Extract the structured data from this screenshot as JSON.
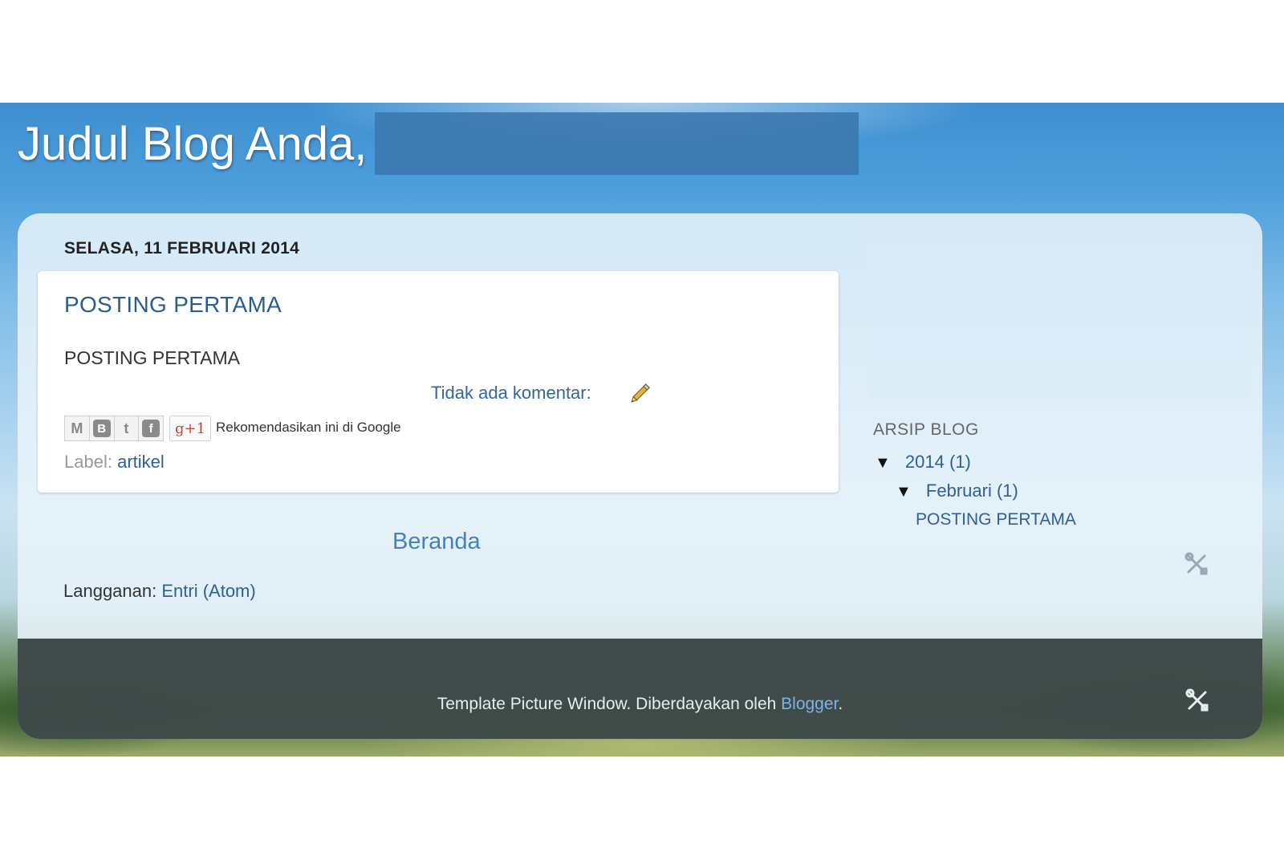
{
  "header": {
    "title": "Judul Blog Anda,"
  },
  "main": {
    "date_header": "SELASA, 11 FEBRUARI 2014",
    "post": {
      "title": "POSTING PERTAMA",
      "body": "POSTING PERTAMA",
      "comment_link": "Tidak ada komentar:",
      "share_buttons": [
        "M",
        "B",
        "t",
        "f"
      ],
      "gplus_label": "g+1",
      "recommend_text": "Rekomendasikan ini di Google",
      "labels_prefix": "Label:",
      "label_link": "artikel"
    },
    "home_link": "Beranda",
    "subscribe_prefix": "Langganan:",
    "subscribe_link": "Entri (Atom)"
  },
  "sidebar": {
    "archive_heading": "ARSIP BLOG",
    "year_toggle": "▼",
    "year_label": "2014",
    "year_count": "(1)",
    "month_toggle": "▼",
    "month_label": "Februari",
    "month_count": "(1)",
    "post_link": "POSTING PERTAMA"
  },
  "footer": {
    "text": "Template Picture Window. Diberdayakan oleh",
    "link": "Blogger",
    "suffix": "."
  }
}
